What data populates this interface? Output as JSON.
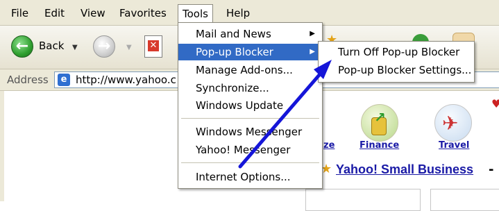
{
  "menubar": {
    "items": [
      "File",
      "Edit",
      "View",
      "Favorites",
      "Tools",
      "Help"
    ],
    "active": "Tools"
  },
  "toolbar": {
    "back_label": "Back",
    "back_icon": "back-arrow-icon",
    "forward_icon": "forward-arrow-icon",
    "stop_icon": "stop-icon"
  },
  "address": {
    "label": "Address",
    "value": "http://www.yahoo.c"
  },
  "tools_menu": {
    "items": [
      {
        "label": "Mail and News",
        "has_submenu": true
      },
      {
        "label": "Pop-up Blocker",
        "has_submenu": true,
        "highlighted": true
      },
      {
        "label": "Manage Add-ons...",
        "has_submenu": false
      },
      {
        "label": "Synchronize...",
        "has_submenu": false
      },
      {
        "label": "Windows Update",
        "has_submenu": false
      },
      {
        "label": "Windows Messenger",
        "has_submenu": false
      },
      {
        "label": "Yahoo! Messenger",
        "has_submenu": false
      },
      {
        "label": "Internet Options...",
        "has_submenu": false
      }
    ]
  },
  "popup_submenu": {
    "items": [
      {
        "label": "Turn Off Pop-up Blocker"
      },
      {
        "label": "Pop-up Blocker Settings..."
      }
    ]
  },
  "page": {
    "partial_link": "ze",
    "finance_label": "Finance",
    "travel_label": "Travel",
    "small_business": "Yahoo! Small Business",
    "dash": "-"
  },
  "colors": {
    "menu_bg": "#ece9d8",
    "highlight": "#316ac5",
    "arrow": "#1515d8",
    "link": "#1a1aa6"
  }
}
